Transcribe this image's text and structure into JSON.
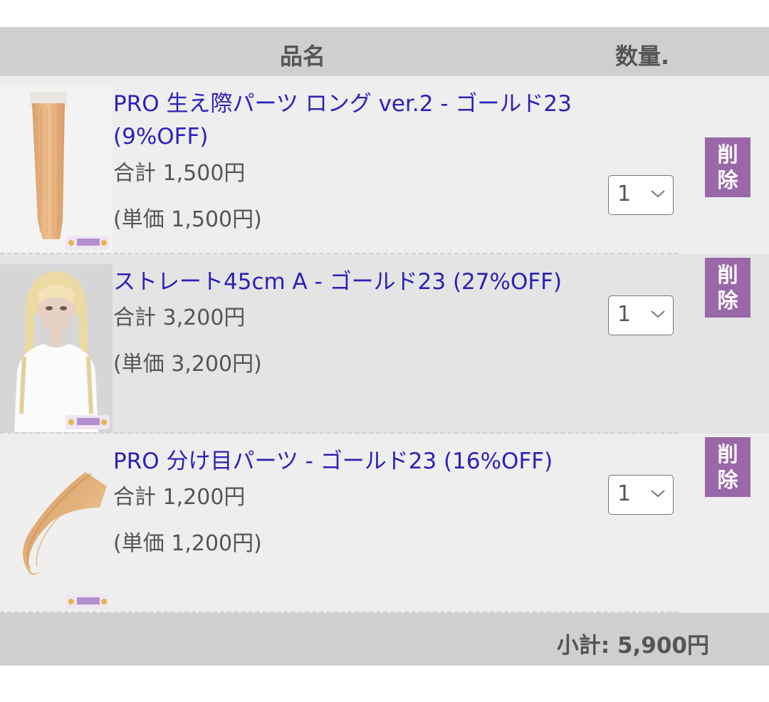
{
  "header": {
    "name_label": "品名",
    "qty_label": "数量."
  },
  "items": [
    {
      "title": "PRO 生え際パーツ ロング ver.2 - ゴールド23 (9%OFF)",
      "total": "合計 1,500円",
      "unit": "(単価 1,500円)",
      "quantity": "1",
      "delete_label": [
        "削",
        "除"
      ],
      "image_icon": "hair-extension-long-straight"
    },
    {
      "title": "ストレート45cm A - ゴールド23 (27%OFF)",
      "total": "合計 3,200円",
      "unit": "(単価 3,200円)",
      "quantity": "1",
      "delete_label": [
        "削",
        "除"
      ],
      "image_icon": "mannequin-wig-blonde"
    },
    {
      "title": "PRO 分け目パーツ - ゴールド23 (16%OFF)",
      "total": "合計 1,200円",
      "unit": "(単価 1,200円)",
      "quantity": "1",
      "delete_label": [
        "削",
        "除"
      ],
      "image_icon": "hair-part-piece-curved"
    }
  ],
  "subtotal": "小計: 5,900円",
  "colors": {
    "link": "#2d21b7",
    "delete_button": "#9a68a8",
    "header_bg": "#cfcfcf",
    "text_gray": "#555555"
  }
}
